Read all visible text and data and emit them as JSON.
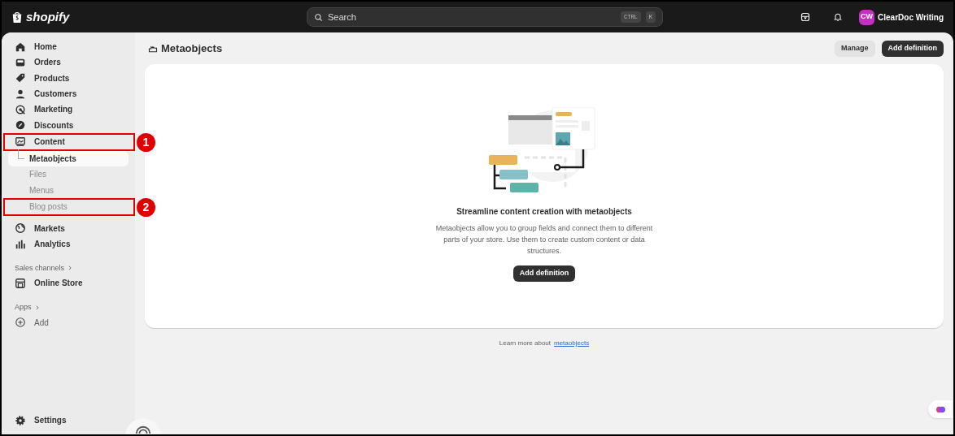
{
  "topbar": {
    "logo": "shopify",
    "search": {
      "placeholder": "Search",
      "keys": [
        "CTRL",
        "K"
      ]
    },
    "avatar": "CW",
    "store": "ClearDoc Writing"
  },
  "sidebar": {
    "items": [
      {
        "label": "Home",
        "kind": "main",
        "selected": false
      },
      {
        "label": "Orders",
        "kind": "main",
        "selected": false
      },
      {
        "label": "Products",
        "kind": "main",
        "selected": false
      },
      {
        "label": "Customers",
        "kind": "main",
        "selected": false
      },
      {
        "label": "Marketing",
        "kind": "main",
        "selected": false
      },
      {
        "label": "Discounts",
        "kind": "main",
        "selected": false
      },
      {
        "label": "Content",
        "kind": "main",
        "selected": false,
        "callout": "1"
      },
      {
        "label": "Metaobjects",
        "kind": "sub",
        "selected": true
      },
      {
        "label": "Files",
        "kind": "sub",
        "selected": false
      },
      {
        "label": "Menus",
        "kind": "sub",
        "selected": false
      },
      {
        "label": "Blog posts",
        "kind": "sub",
        "selected": false,
        "callout": "2"
      },
      {
        "label": "Markets",
        "kind": "main",
        "selected": false
      },
      {
        "label": "Analytics",
        "kind": "main",
        "selected": false
      }
    ],
    "sections": [
      {
        "heading": "Sales channels",
        "items": [
          {
            "label": "Online Store"
          }
        ]
      },
      {
        "heading": "Apps",
        "items": [
          {
            "label": "Add"
          }
        ]
      }
    ],
    "footer": "Settings"
  },
  "page": {
    "title": "Metaobjects",
    "buttons": [
      "Manage",
      "Add definition"
    ],
    "empty_state": {
      "heading": "Streamline content creation with metaobjects",
      "body": "Metaobjects allow you to group fields and connect them to different parts of your store. Use them to create custom content or data structures.",
      "button": "Add definition"
    },
    "learn_more": {
      "text": "Learn more about",
      "link": "metaobjects"
    }
  }
}
